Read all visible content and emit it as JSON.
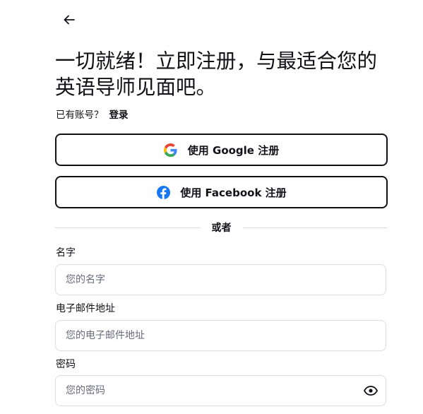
{
  "header": {
    "back_icon": "arrow-left-icon",
    "title": "一切就绪！立即注册，与最适合您的英语导师见面吧。"
  },
  "login_prompt": {
    "question": "已有账号？",
    "link": "登录"
  },
  "social": {
    "google": {
      "label": "使用 Google 注册",
      "icon": "google-icon"
    },
    "facebook": {
      "label": "使用 Facebook 注册",
      "icon": "facebook-icon",
      "color": "#1877f2"
    }
  },
  "divider": {
    "text": "或者"
  },
  "form": {
    "name": {
      "label": "名字",
      "placeholder": "您的名字",
      "value": ""
    },
    "email": {
      "label": "电子邮件地址",
      "placeholder": "您的电子邮件地址",
      "value": ""
    },
    "password": {
      "label": "密码",
      "placeholder": "您的密码",
      "value": "",
      "toggle_icon": "eye-icon"
    }
  },
  "colors": {
    "text": "#121117",
    "border": "#dcdce5",
    "placeholder": "#6a697c"
  }
}
